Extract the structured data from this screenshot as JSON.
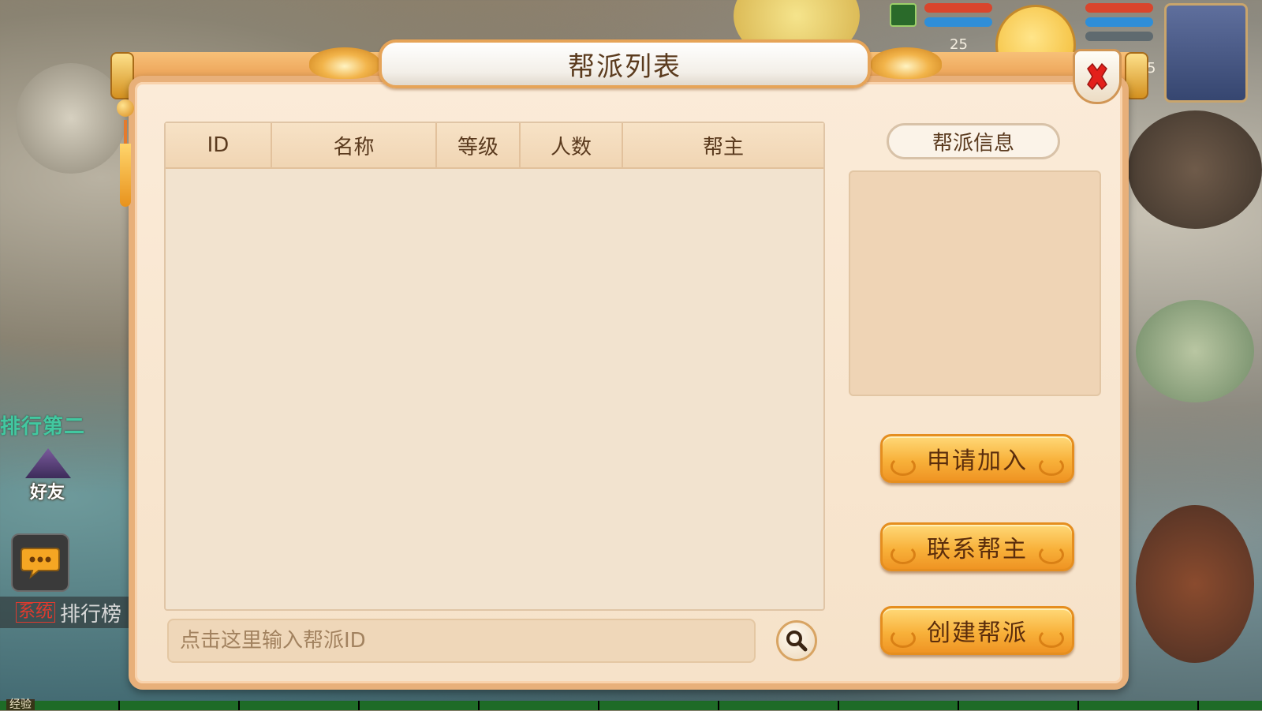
{
  "dialog": {
    "title": "帮派列表",
    "close_icon": "close-icon"
  },
  "table": {
    "columns": [
      "ID",
      "名称",
      "等级",
      "人数",
      "帮主"
    ],
    "rows": []
  },
  "search": {
    "placeholder": "点击这里输入帮派ID",
    "icon": "search-icon"
  },
  "info": {
    "label": "帮派信息"
  },
  "actions": {
    "join": "申请加入",
    "contact": "联系帮主",
    "create": "创建帮派"
  },
  "hud": {
    "level_1": "25",
    "level_2": "5",
    "friend_label": "好友",
    "rank_text": "排行第二",
    "system_tag": "系统",
    "system_msg": "排行榜",
    "exp_label": "经验",
    "colors": {
      "hp": "#d9452c",
      "mp": "#2f8ed8"
    }
  },
  "theme": {
    "accent": "#f3a53b",
    "panel": "#f6e2c9",
    "text": "#5a3a1e"
  }
}
